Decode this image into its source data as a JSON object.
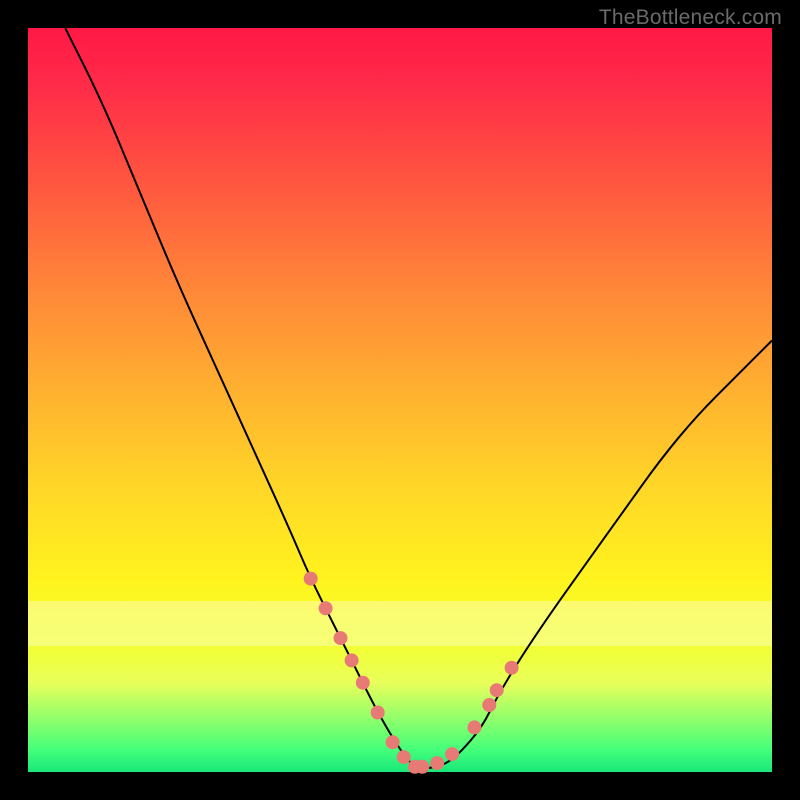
{
  "watermark": "TheBottleneck.com",
  "colors": {
    "frame_border": "#000000",
    "gradient_top": "#ff1946",
    "gradient_bottom": "#19e77a",
    "curve": "#000000",
    "dots": "#e77a74"
  },
  "chart_data": {
    "type": "line",
    "title": "",
    "xlabel": "",
    "ylabel": "",
    "xlim": [
      0,
      100
    ],
    "ylim": [
      0,
      100
    ],
    "note": "Axes have no tick labels in the image; values are normalized 0..100 estimated from pixel positions. The curve is a V-like bottleneck shape with its minimum near x≈52 at y≈0, rising steeply toward both sides.",
    "series": [
      {
        "name": "bottleneck-curve",
        "x": [
          5,
          10,
          15,
          20,
          25,
          30,
          35,
          38,
          41,
          44,
          47,
          50,
          52,
          54,
          56,
          58,
          61,
          63,
          66,
          70,
          75,
          80,
          85,
          90,
          95,
          100
        ],
        "y": [
          100,
          90,
          78,
          66,
          55,
          44,
          33,
          26,
          20,
          14,
          8,
          3,
          0.5,
          0.5,
          1,
          2.5,
          6,
          10,
          15,
          21,
          28,
          35,
          42,
          48,
          53,
          58
        ]
      }
    ],
    "marker_points": {
      "name": "highlighted-dots",
      "x": [
        38,
        40,
        42,
        43.5,
        45,
        47,
        49,
        50.5,
        52,
        53,
        55,
        57,
        60,
        62,
        63,
        65
      ],
      "y": [
        26,
        22,
        18,
        15,
        12,
        8,
        4,
        2,
        0.7,
        0.7,
        1.2,
        2.4,
        6,
        9,
        11,
        14
      ]
    },
    "pale_band_y": [
      17,
      23
    ]
  }
}
